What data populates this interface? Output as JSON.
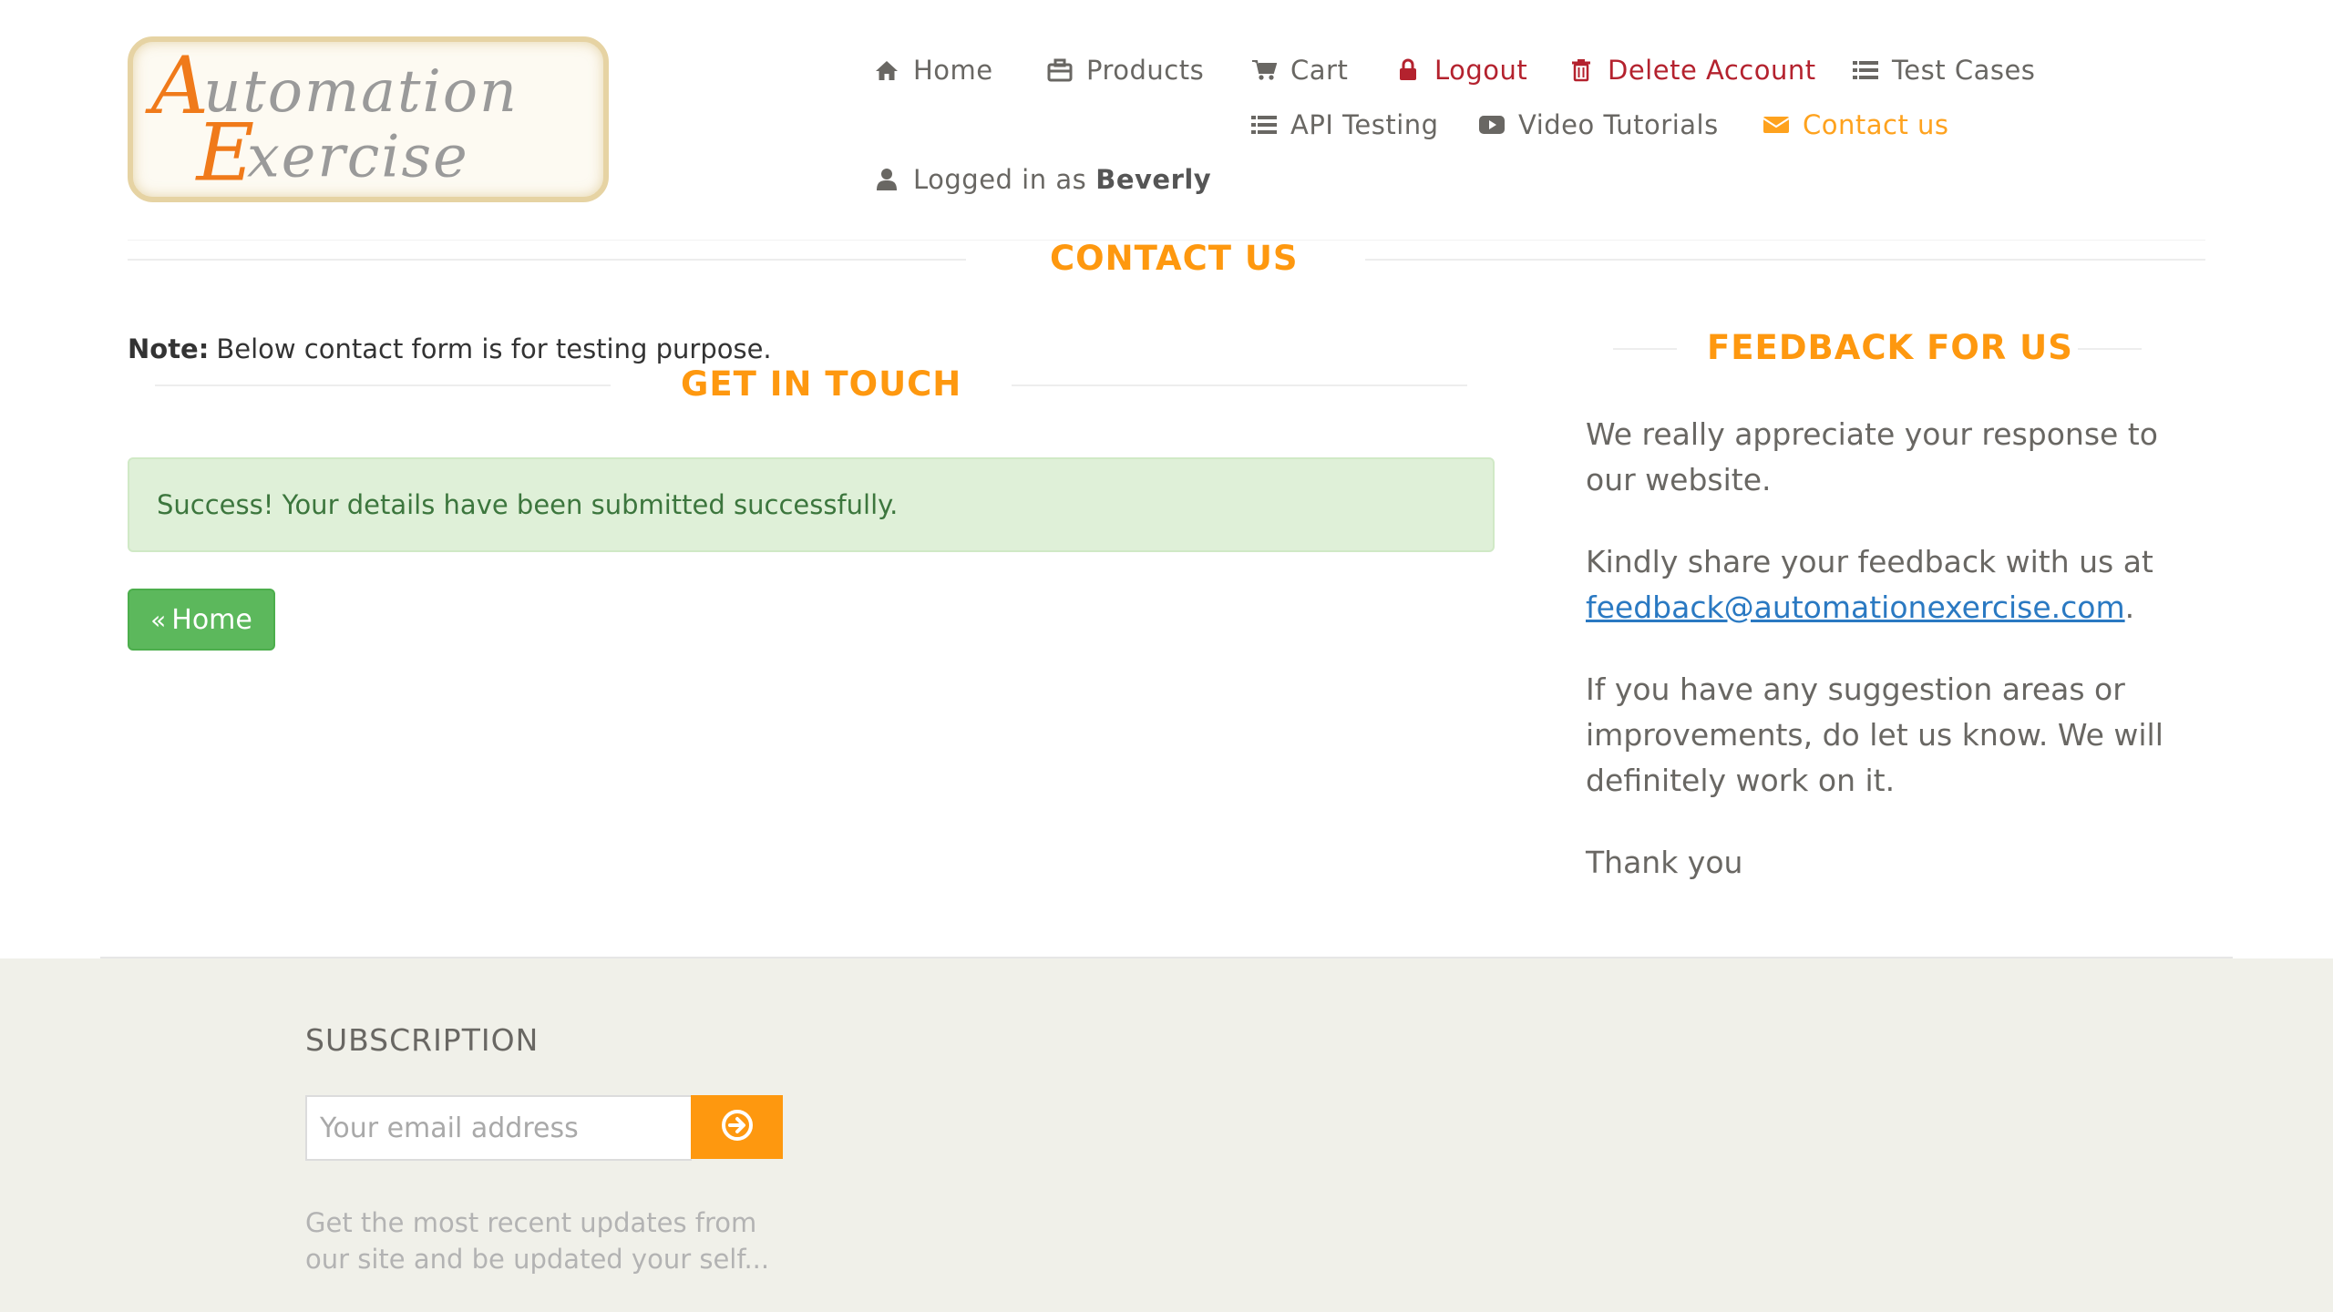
{
  "logo": {
    "line1": "Automation",
    "line2": "Exercise"
  },
  "nav": {
    "home": "Home",
    "products": "Products",
    "cart": "Cart",
    "logout": "Logout",
    "delete_account": "Delete Account",
    "test_cases": "Test Cases",
    "api_testing": "API Testing",
    "video_tutorials": "Video Tutorials",
    "contact_us": "Contact us",
    "logged_in_prefix": "Logged in as",
    "logged_in_user": "Beverly"
  },
  "page": {
    "title": "CONTACT US",
    "note_label": "Note:",
    "note_text": "Below contact form is for testing purpose.",
    "get_in_touch": "GET IN TOUCH",
    "success_message": "Success! Your details have been submitted successfully.",
    "home_button": "Home"
  },
  "feedback": {
    "title": "FEEDBACK FOR US",
    "p1": "We really appreciate your response to our website.",
    "p2_prefix": "Kindly share your feedback with us at",
    "email": "feedback@automationexercise.com",
    "p2_suffix": ".",
    "p3": "If you have any suggestion areas or improvements, do let us know. We will definitely work on it.",
    "p4": "Thank you"
  },
  "footer": {
    "subscription_title": "SUBSCRIPTION",
    "email_placeholder": "Your email address",
    "subscription_note": "Get the most recent updates from our site and be updated your self..."
  },
  "colors": {
    "accent": "#fe980f",
    "danger": "#b4222e",
    "success_bg": "#dff0d8",
    "success_text": "#3c763d",
    "button_green": "#5cb85c",
    "link": "#2a79c2",
    "footer_bg": "#f0f0e9"
  },
  "icons": {
    "home": "home-icon",
    "products": "briefcase-icon",
    "cart": "cart-icon",
    "logout": "lock-icon",
    "delete": "trash-icon",
    "list": "list-icon",
    "video": "video-icon",
    "mail": "envelope-icon",
    "user": "user-icon",
    "subscribe": "arrow-circle-right-icon",
    "back": "double-chevron-left-icon"
  }
}
